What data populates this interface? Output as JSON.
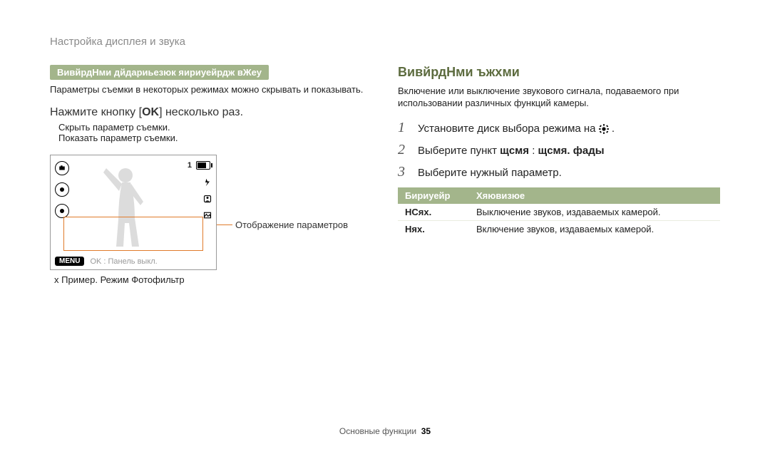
{
  "breadcrumb": "Настройка дисплея и звука",
  "left": {
    "tag": "ВивйрдНми дйдариьезюк яириуейрдж вЖеу",
    "desc": "Параметры съемки в некоторых режимах можно скрывать и показывать.",
    "instruction_pre": "Нажмите кнопку [",
    "instruction_ok": "OK",
    "instruction_post": "] несколько раз.",
    "sublist_a": "Скрыть параметр съемки.",
    "sublist_b": "Показать параметр съемки.",
    "annotation": "Отображение параметров",
    "status_number": "1",
    "menu_label": "MENU",
    "ok_panel": "OK : Панель выкл.",
    "example_note": "x  Пример. Режим Фотофильтр"
  },
  "right": {
    "heading": "ВивйрдНми ъжхми",
    "desc": "Включение или выключение звукового сигнала, подаваемого при использовании различных функций камеры.",
    "steps": [
      {
        "n": "1",
        "pre": "Установите диск выбора режима на ",
        "icon": "gear",
        "post": " ."
      },
      {
        "n": "2",
        "pre": "Выберите пункт ",
        "b1": "щсмя",
        "mid": " : ",
        "b2": "щсмя. фады"
      },
      {
        "n": "3",
        "pre": "Выберите нужный параметр."
      }
    ],
    "table": {
      "th1": "Бириуейр",
      "th2": "Хяювизюе",
      "rows": [
        {
          "opt": "НСях.",
          "desc": "Выключение звуков, издаваемых камерой."
        },
        {
          "opt": "Нях.",
          "desc": "Включение звуков, издаваемых камерой."
        }
      ]
    }
  },
  "footer": {
    "section": "Основные функции",
    "page": "35"
  }
}
